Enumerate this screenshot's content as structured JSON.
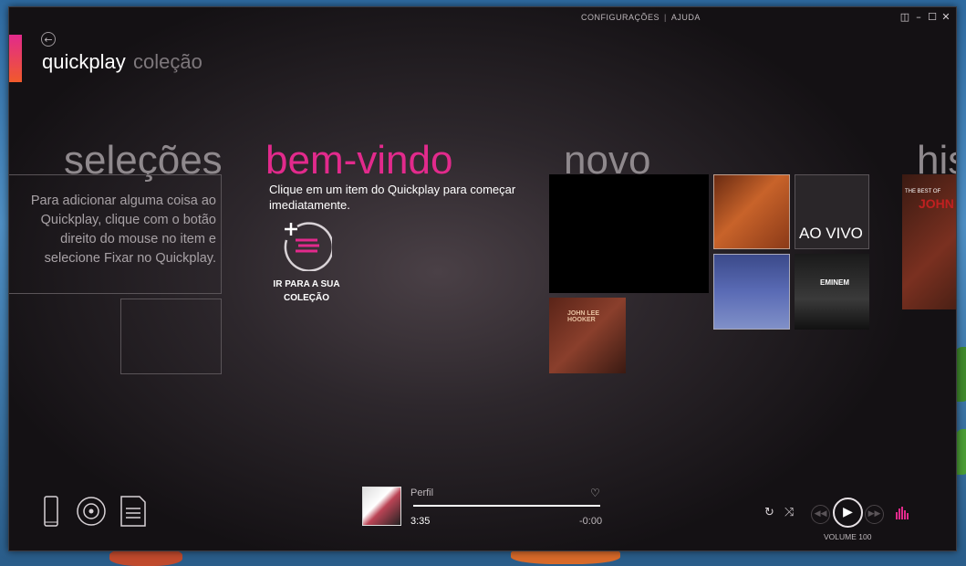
{
  "app": {
    "nav": {
      "title": "quickplay",
      "subtitle": "coleção"
    },
    "top_links": {
      "settings": "CONFIGURAÇÕES",
      "separator": "|",
      "help": "AJUDA"
    },
    "window_controls": [
      "◫",
      "–",
      "☐",
      "✕"
    ]
  },
  "sections": {
    "selections": {
      "heading": "seleções",
      "pin_hint": "Para adicionar alguma coisa ao Quickplay, clique com o botão direito do mouse no item e selecione Fixar no Quickplay."
    },
    "welcome": {
      "heading": "bem-vindo",
      "text": "Clique em um item do Quickplay para começar imediatamente.",
      "collection_label": "IR PARA A SUA COLEÇÃO"
    },
    "new": {
      "heading": "novo",
      "live_label": "AO VIVO"
    },
    "history": {
      "heading": "his"
    }
  },
  "tiles": {
    "hooker": "JOHN LEE HOOKER",
    "eminem": "EMINEM",
    "bestof": "THE BEST OF",
    "hooker_big": "JOHN"
  },
  "now_playing": {
    "title": "Perfil",
    "elapsed": "3:35",
    "remaining": "-0:00",
    "progress": 1.0
  },
  "player": {
    "volume_label": "VOLUME 100"
  },
  "colors": {
    "accent_pink": "#e22a8c",
    "accent_orange": "#f15a2b"
  },
  "icons": {
    "back": "back-arrow-icon",
    "device": "phone-icon",
    "disc": "disc-icon",
    "playlist": "playlist-icon",
    "repeat": "repeat-icon",
    "shuffle": "shuffle-icon",
    "prev": "previous-icon",
    "play": "play-icon",
    "next": "next-icon",
    "eq": "equalizer-icon",
    "heart": "heart-icon"
  }
}
